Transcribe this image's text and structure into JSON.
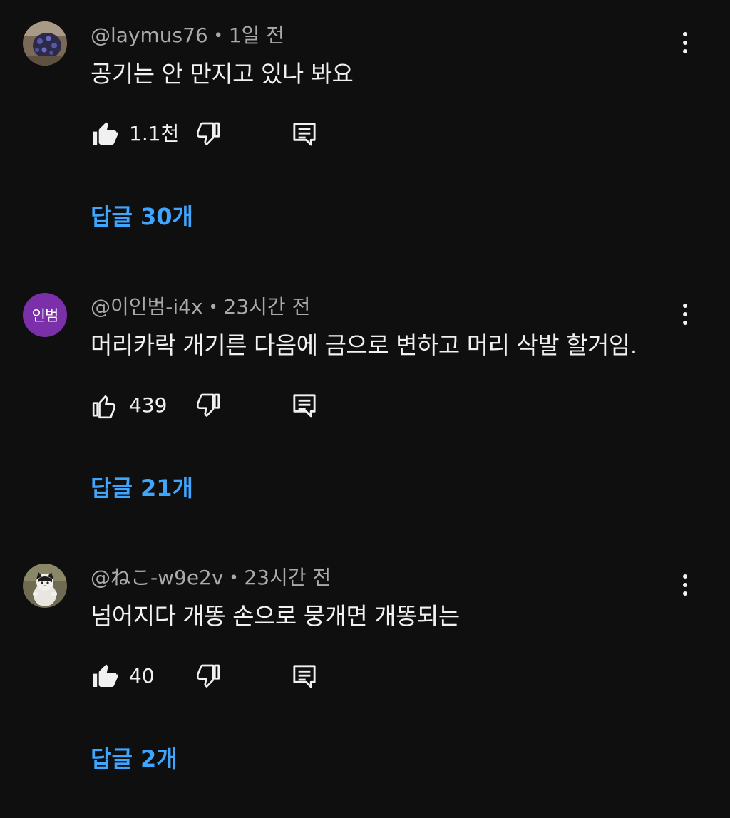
{
  "comments": [
    {
      "avatar_icon": "photo-avatar-icon",
      "author": "@laymus76",
      "time": "1일 전",
      "text": "공기는 안 만지고 있나 봐요",
      "likes": "1.1천",
      "liked": true,
      "replies_label": "답글 30개"
    },
    {
      "avatar_letters": "인범",
      "avatar_color": "#7b2fa8",
      "author": "@이인범-i4x",
      "time": "23시간 전",
      "text": "머리카락 개기른 다음에 금으로 변하고 머리 삭발 할거임.",
      "likes": "439",
      "liked": false,
      "replies_label": "답글 21개"
    },
    {
      "avatar_icon": "cat-photo-avatar-icon",
      "author": "@ねこ-w9e2v",
      "time": "23시간 전",
      "text": "넘어지다 개똥 손으로 뭉개면 개똥되는",
      "likes": "40",
      "liked": true,
      "replies_label": "답글 2개"
    }
  ],
  "separator": "•",
  "colors": {
    "background": "#0f0f0f",
    "text_primary": "#f1f1f1",
    "text_secondary": "#aaaaaa",
    "link": "#3ea6ff"
  }
}
